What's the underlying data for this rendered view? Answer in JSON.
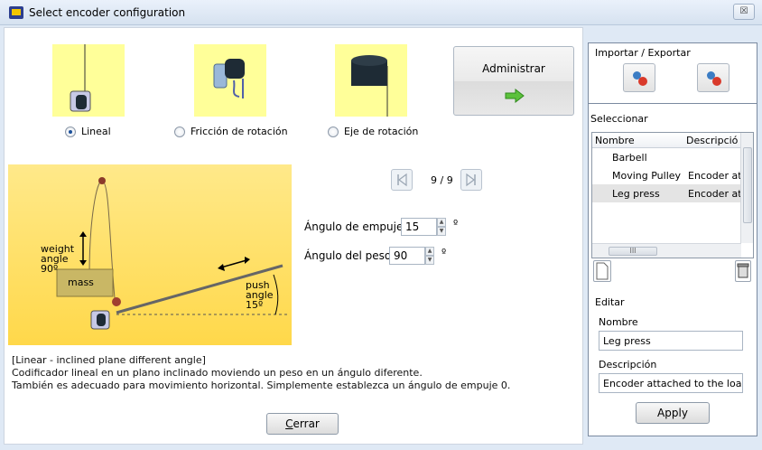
{
  "window": {
    "title": "Select encoder configuration",
    "close_glyph": "☒"
  },
  "modes": [
    {
      "label": "Lineal",
      "checked": true
    },
    {
      "label": "Fricción de rotación",
      "checked": false
    },
    {
      "label": "Eje de rotación",
      "checked": false
    }
  ],
  "admin": {
    "label": "Administrar",
    "icon": "green-arrow-right-icon"
  },
  "nav": {
    "counter": "9 / 9"
  },
  "diagram": {
    "weight_label": "weight\nangle\n90º",
    "mass_label": "mass",
    "push_label": "push\nangle\n15º"
  },
  "params": {
    "push_angle_label": "Ángulo de empuje",
    "push_angle_value": "15",
    "weight_angle_label": "Ángulo del peso",
    "weight_angle_value": "90",
    "unit": "º"
  },
  "description": {
    "line1": "[Linear - inclined plane different angle]",
    "line2": "Codificador lineal en un plano inclinado moviendo un peso en un ángulo diferente.",
    "line3": "También es adecuado para movimiento horizontal. Simplemente establezca un ángulo de empuje 0."
  },
  "close_button": {
    "accel": "C",
    "rest": "errar"
  },
  "right": {
    "import_export_label": "Importar / Exportar",
    "select_label": "Seleccionar",
    "columns": [
      "Nombre",
      "Descripción"
    ],
    "rows": [
      {
        "name": "Barbell",
        "desc": ""
      },
      {
        "name": "Moving Pulley",
        "desc": "Encoder attached to"
      },
      {
        "name": "Leg press",
        "desc": "Encoder attached to"
      }
    ],
    "scroll_glyph": "III",
    "edit_label": "Editar",
    "name_label": "Nombre",
    "name_value": "Leg press",
    "desc_label": "Descripción",
    "desc_value": "Encoder attached to the load",
    "apply_label": "Apply"
  }
}
